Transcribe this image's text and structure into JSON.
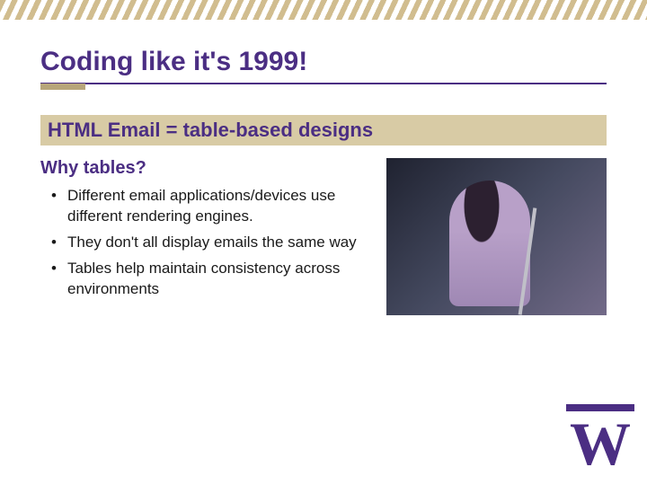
{
  "title": "Coding like it's 1999!",
  "subtitle": "HTML Email = table-based designs",
  "question": "Why tables?",
  "bullets": [
    "Different email applications/devices use different rendering engines.",
    "They don't all display emails the same way",
    "Tables help maintain consistency across environments"
  ],
  "logo_letter": "W",
  "image_alt": "Performer at microphone"
}
